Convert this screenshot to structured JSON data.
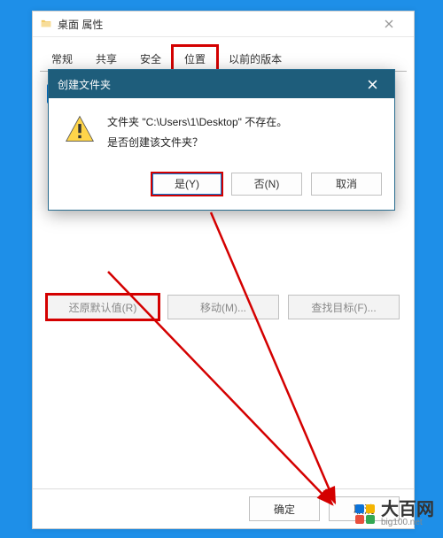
{
  "window": {
    "title": "桌面 属性",
    "tabs": [
      "常规",
      "共享",
      "安全",
      "位置",
      "以前的版本"
    ],
    "active_tab_index": 3
  },
  "disabled_buttons": {
    "restore": "还原默认值(R)",
    "move": "移动(M)...",
    "find": "查找目标(F)..."
  },
  "bottom": {
    "ok": "确定",
    "cancel": "取消"
  },
  "dialog": {
    "title": "创建文件夹",
    "line1": "文件夹 \"C:\\Users\\1\\Desktop\" 不存在。",
    "line2": "是否创建该文件夹？",
    "yes": "是(Y)",
    "no": "否(N)",
    "cancel": "取消"
  },
  "watermark": {
    "name": "大百网",
    "domain": "big100.net"
  }
}
